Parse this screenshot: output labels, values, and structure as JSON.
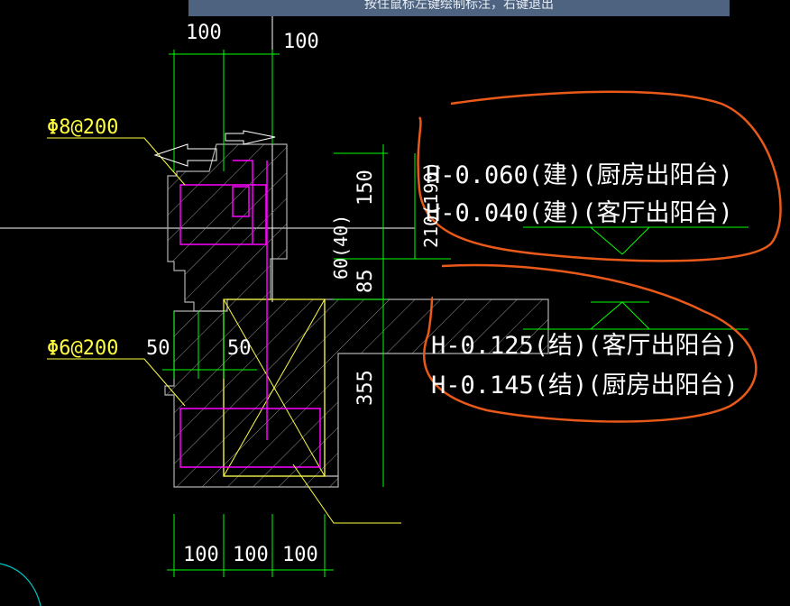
{
  "status_banner": {
    "text": "按住鼠标左键绘制标注，右键退出"
  },
  "rebar_labels": {
    "top": "Φ8@200",
    "bottom": "Φ6@200"
  },
  "dimensions": {
    "top_left": "100",
    "top_right": "100",
    "side_150": "150",
    "side_85": "85",
    "side_210": "210(190)",
    "side_60": "60(40)",
    "side_355": "355",
    "mid_50_left": "50",
    "mid_50_right": "50",
    "bottom_1": "100",
    "bottom_2": "100",
    "bottom_3": "100"
  },
  "elevations": [
    {
      "text": "H-0.060(建)(厨房出阳台)"
    },
    {
      "text": "H-0.040(建)(客厅出阳台)"
    },
    {
      "text": "H-0.125(结)(客厅出阳台)"
    },
    {
      "text": "H-0.145(结)(厨房出阳台)"
    }
  ],
  "colors": {
    "background": "#000000",
    "dim_green": "#00ff00",
    "label_yellow": "#ffff40",
    "rebar_magenta": "#ff00ff",
    "concrete_gray": "#b0b0b0",
    "text_white": "#ffffff",
    "markup_orange": "#e8591a"
  }
}
